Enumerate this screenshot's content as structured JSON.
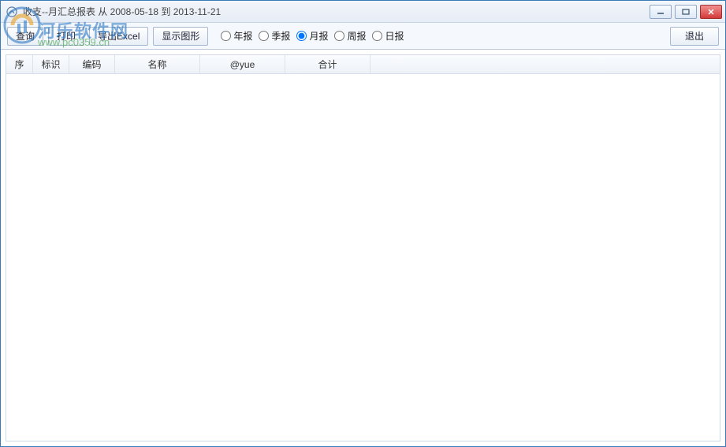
{
  "window": {
    "title": "收支--月汇总报表 从 2008-05-18 到 2013-11-21"
  },
  "toolbar": {
    "query_label": "查询",
    "print_label": "打印",
    "export_label": "导出Excel",
    "show_chart_label": "显示图形",
    "exit_label": "退出"
  },
  "report_period": {
    "options": [
      {
        "label": "年报",
        "value": "year",
        "checked": false
      },
      {
        "label": "季报",
        "value": "quarter",
        "checked": false
      },
      {
        "label": "月报",
        "value": "month",
        "checked": true
      },
      {
        "label": "周报",
        "value": "week",
        "checked": false
      },
      {
        "label": "日报",
        "value": "day",
        "checked": false
      }
    ]
  },
  "grid": {
    "columns": {
      "seq": "序",
      "flag": "标识",
      "code": "编码",
      "name": "名称",
      "yue": "@yue",
      "total": "合计"
    },
    "rows": []
  },
  "watermark": {
    "text": "河乐软件网",
    "url": "www.pc0359.cn"
  }
}
